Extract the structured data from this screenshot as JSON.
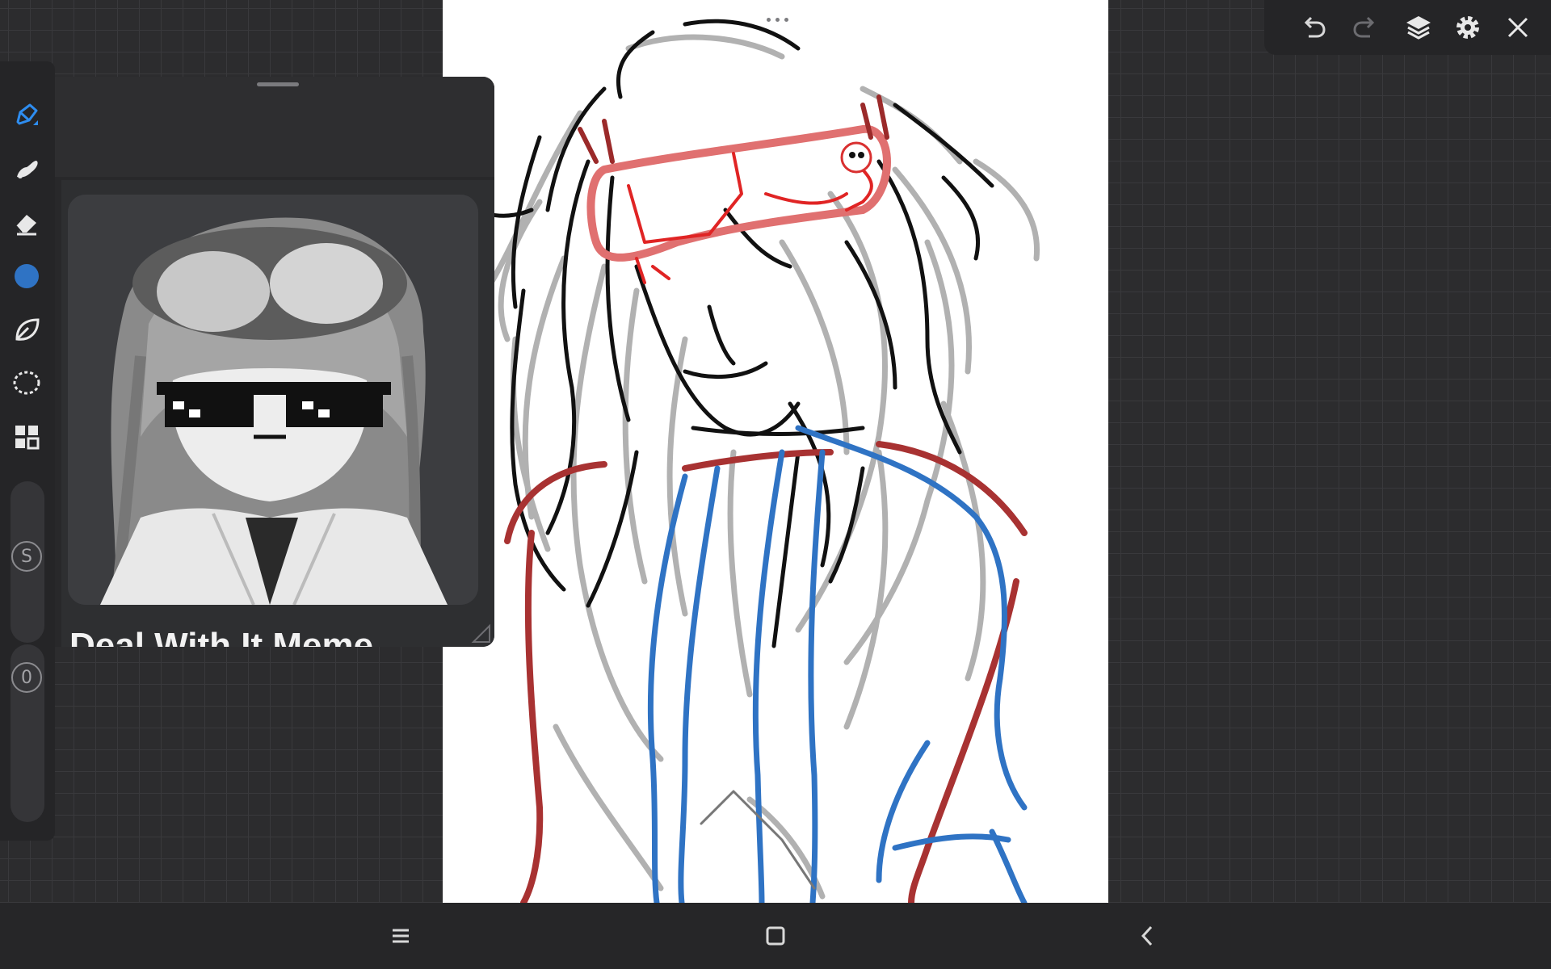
{
  "reference": {
    "caption": "Deal With It Meme"
  },
  "toolbar": {
    "slider_size_badge": "S",
    "slider_opacity_badge": "0"
  },
  "colors": {
    "active_tool": "#2e8df0",
    "current_color": "#2f73c4",
    "ui_background": "#2c2c2e",
    "panel": "#252527"
  },
  "icons": {
    "tools": [
      "pen-icon",
      "smudge-icon",
      "eraser-icon",
      "color-swatch",
      "leaf-icon",
      "lasso-icon",
      "gallery-icon"
    ],
    "top": [
      "undo-icon",
      "redo-icon",
      "layers-icon",
      "settings-icon",
      "close-icon"
    ],
    "nav": [
      "recents-icon",
      "home-icon",
      "back-icon"
    ]
  }
}
